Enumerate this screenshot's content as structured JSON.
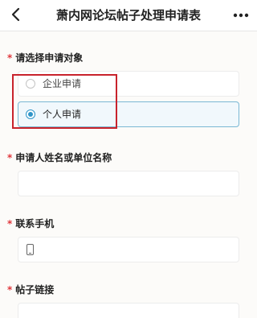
{
  "header": {
    "title": "萧内网论坛帖子处理申请表"
  },
  "form": {
    "applicant_type": {
      "required_mark": "*",
      "label": "请选择申请对象",
      "options": [
        {
          "label": "企业申请",
          "selected": false
        },
        {
          "label": "个人申请",
          "selected": true
        }
      ]
    },
    "applicant_name": {
      "required_mark": "*",
      "label": "申请人姓名或单位名称",
      "value": ""
    },
    "phone": {
      "required_mark": "*",
      "label": "联系手机",
      "value": ""
    },
    "post_link": {
      "required_mark": "*",
      "label": "帖子链接",
      "value": ""
    }
  },
  "colors": {
    "required": "#e0373c",
    "accent": "#2f95c8",
    "highlight_border": "#c8232c"
  }
}
